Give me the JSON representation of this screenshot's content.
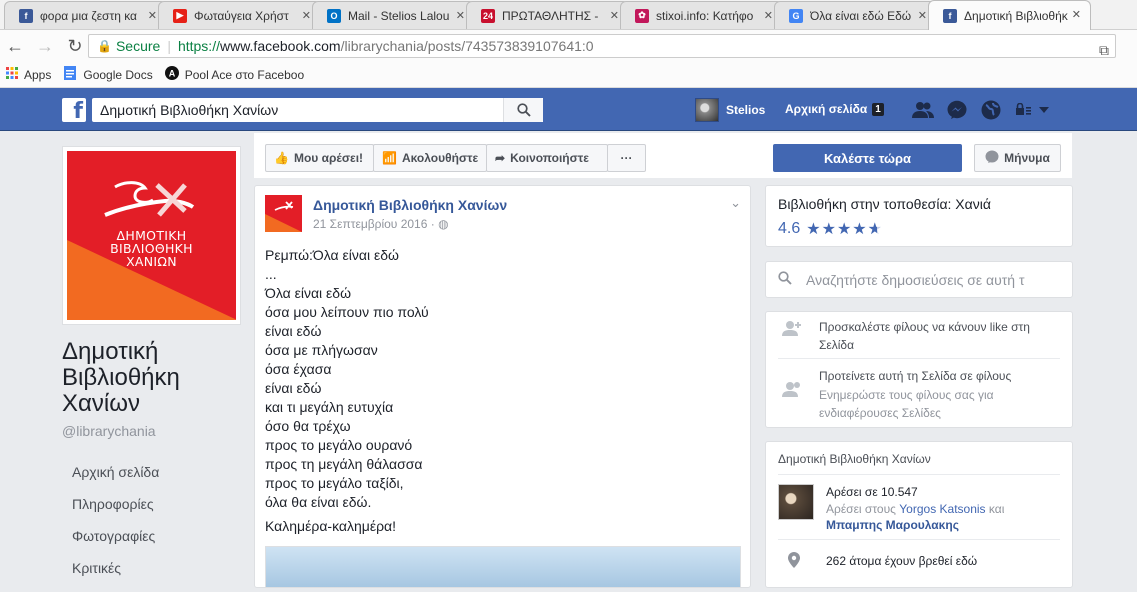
{
  "browser": {
    "tabs": [
      {
        "title": "φορα μια ζεστη κα",
        "fav": "f",
        "color": "#3b5998"
      },
      {
        "title": "Φωταύγεια Χρήστ",
        "fav": "▶",
        "color": "#e62117"
      },
      {
        "title": "Mail - Stelios Lalou",
        "fav": "O",
        "color": "#0072c6"
      },
      {
        "title": "ΠΡΩΤΑΘΛΗΤΗΣ -",
        "fav": "24",
        "color": "#c8102e"
      },
      {
        "title": "stixoi.info: Κατήφο",
        "fav": "✿",
        "color": "#c2185b"
      },
      {
        "title": "Όλα είναι εδώ Εδώ",
        "fav": "G",
        "color": "#4285f4"
      },
      {
        "title": "Δημοτική Βιβλιοθήκ",
        "fav": "f",
        "color": "#3b5998"
      }
    ],
    "tab_close": "✕",
    "nav": {
      "back": "←",
      "forward": "→",
      "reload": "↻"
    },
    "secure_label": "Secure",
    "url_prefix": "https://",
    "url_domain": "www.facebook.com",
    "url_path": "/librarychania/posts/743573839107641:0",
    "bookmarks": [
      {
        "label": "Apps"
      },
      {
        "label": "Google Docs"
      },
      {
        "label": "Pool Ace στο Faceboo"
      }
    ]
  },
  "fb": {
    "logo": "f",
    "search_value": "Δημοτική Βιβλιοθήκη Χανίων",
    "user": "Stelios",
    "home": "Αρχική σελίδα",
    "home_count": "1"
  },
  "page": {
    "logo_text": [
      "ΔΗΜΟΤΙΚΗ",
      "ΒΙΒΛΙΟΘΗΚΗ",
      "ΧΑΝΙΩΝ"
    ],
    "name": "Δημοτική Βιβλιοθήκη Χανίων",
    "handle": "@librarychania",
    "nav": [
      "Αρχική σελίδα",
      "Πληροφορίες",
      "Φωτογραφίες",
      "Κριτικές"
    ]
  },
  "actions": {
    "like": "Μου αρέσει!",
    "follow": "Ακολουθήστε",
    "share": "Κοινοποιήστε",
    "more": "···",
    "call": "Καλέστε τώρα",
    "message": "Μήνυμα"
  },
  "post": {
    "author": "Δημοτική Βιβλιοθήκη Χανίων",
    "date": "21 Σεπτεμβρίου 2016 ·",
    "lines": [
      "Ρεμπώ:Όλα είναι εδώ",
      "...",
      "Όλα είναι εδώ",
      "όσα μου λείπουν πιο πολύ",
      "είναι εδώ",
      "όσα με πλήγωσαν",
      "όσα έχασα",
      "είναι εδώ",
      "και τι μεγάλη ευτυχία",
      "όσο θα τρέχω",
      "προς το μεγάλο ουρανό",
      "προς τη μεγάλη θάλασσα",
      "προς το μεγάλο ταξίδι,",
      "όλα θα είναι εδώ."
    ],
    "greeting": "Καλημέρα-καλημέρα!"
  },
  "right": {
    "location": "Βιβλιοθήκη στην τοποθεσία: Χανιά",
    "rating": "4.6",
    "rating_value": 4.6,
    "search_placeholder": "Αναζητήστε δημοσιεύσεις σε αυτή τ",
    "invite": "Προσκαλέστε φίλους να κάνουν like στη Σελίδα",
    "suggest_title": "Προτείνετε αυτή τη Σελίδα σε φίλους",
    "suggest_sub": "Ενημερώστε τους φίλους σας για ενδιαφέρουσες Σελίδες",
    "about_title": "Δημοτική Βιβλιοθήκη Χανίων",
    "likes": "Αρέσει σε 10.547",
    "likers_pre": "Αρέσει στους",
    "liker1": "Yorgos Katsonis",
    "likers_and": "και",
    "liker2": "Μπαμπης Μαρουλακης",
    "checkins": "262 άτομα έχουν βρεθεί εδώ"
  }
}
